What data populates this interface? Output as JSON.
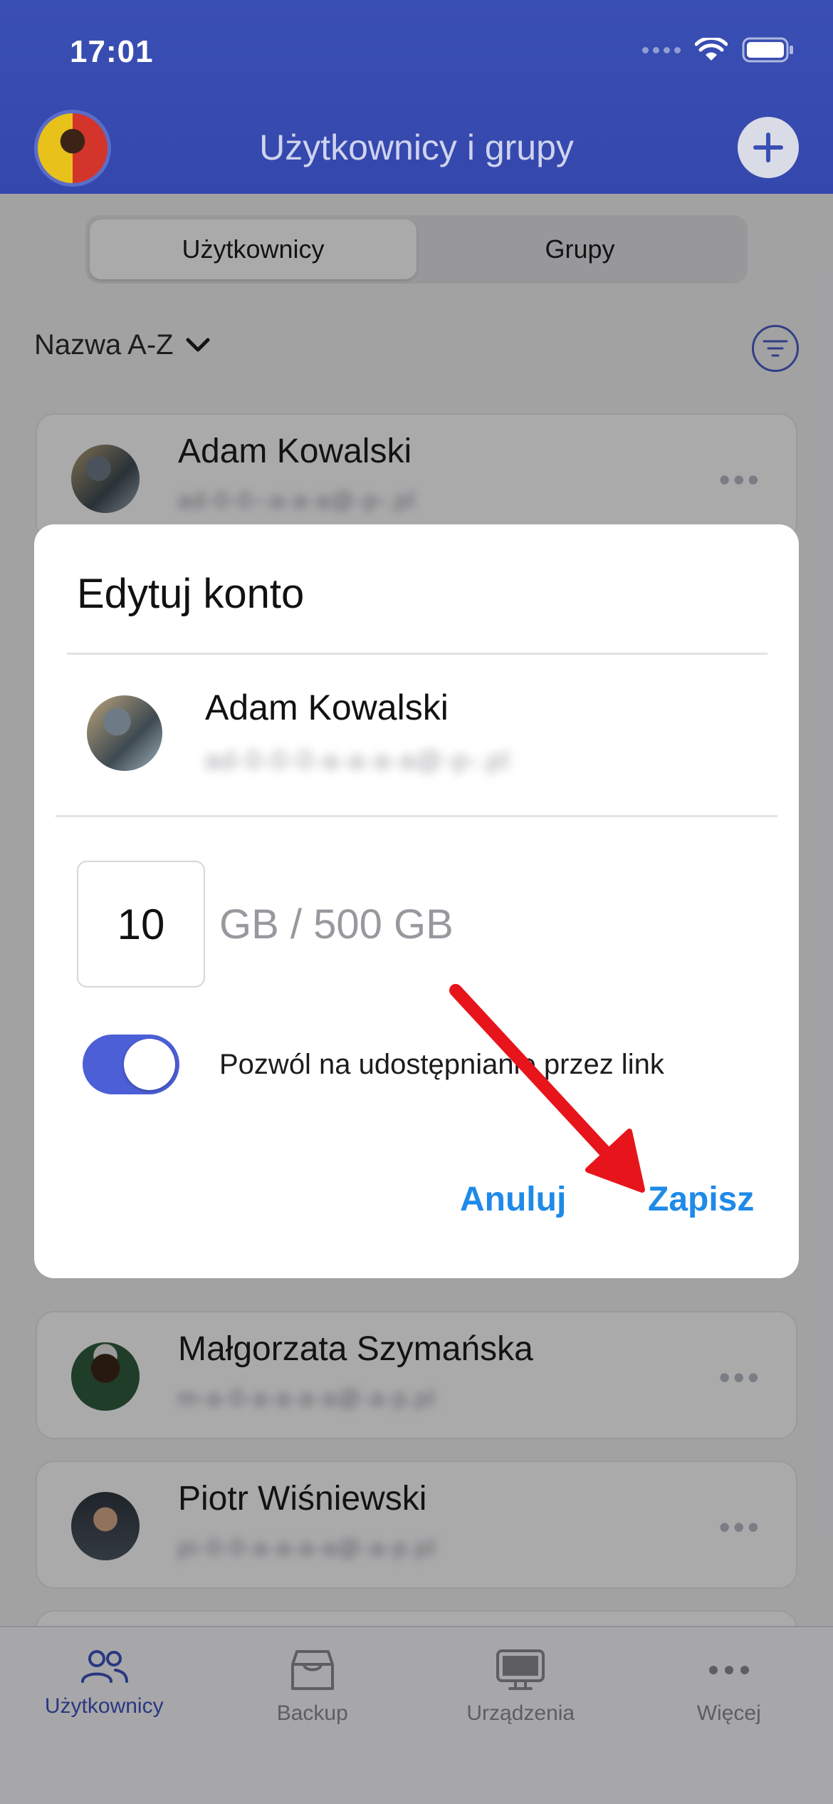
{
  "status_bar": {
    "time": "17:01"
  },
  "header": {
    "title": "Użytkownicy i grupy"
  },
  "segments": [
    {
      "label": "Użytkownicy"
    },
    {
      "label": "Grupy"
    }
  ],
  "sort": {
    "label": "Nazwa A-Z"
  },
  "users": [
    {
      "name": "Adam Kowalski",
      "email": "ad-0-0--a-a-a@-p-.pl"
    },
    {
      "name": "Małgorzata Szymańska",
      "email": "m-a-0-a-a-a-a@-a-p.pl"
    },
    {
      "name": "Piotr Wiśniewski",
      "email": "pi-0-0-a-a-a-a@-a-p.pl"
    }
  ],
  "dialog": {
    "title": "Edytuj konto",
    "user_name": "Adam Kowalski",
    "user_email": "ad-0-0-0-a-a-a-a@-p-.pl",
    "quota_value": "10",
    "quota_unit": "GB / 500 GB",
    "toggle_label": "Pozwól na udostępnianie przez link",
    "toggle_on": true,
    "cancel_label": "Anuluj",
    "save_label": "Zapisz"
  },
  "tabbar": [
    {
      "label": "Użytkownicy",
      "icon": "users-icon",
      "active": true
    },
    {
      "label": "Backup",
      "icon": "backup-box-icon",
      "active": false
    },
    {
      "label": "Urządzenia",
      "icon": "monitor-icon",
      "active": false
    },
    {
      "label": "Więcej",
      "icon": "more-dots-icon",
      "active": false
    }
  ],
  "colors": {
    "accent": "#3d52c0",
    "link": "#1f8ae8",
    "arrow": "#e8141c"
  }
}
